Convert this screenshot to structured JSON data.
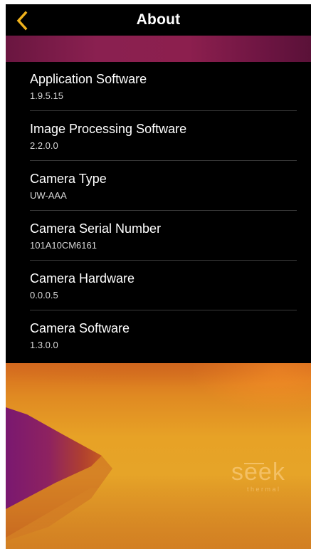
{
  "header": {
    "title": "About",
    "back_icon": "chevron-left-icon",
    "accent_color": "#f0b21c"
  },
  "banner": {
    "color": "#8a2050"
  },
  "about_items": [
    {
      "label": "Application Software",
      "value": "1.9.5.15"
    },
    {
      "label": "Image Processing Software",
      "value": "2.2.0.0"
    },
    {
      "label": "Camera Type",
      "value": "UW-AAA"
    },
    {
      "label": "Camera Serial Number",
      "value": "101A10CM6161"
    },
    {
      "label": "Camera Hardware",
      "value": "0.0.0.5"
    },
    {
      "label": "Camera Software",
      "value": "1.3.0.0"
    }
  ],
  "thermal_view": {
    "logo_text": "seek",
    "logo_subtext": "thermal"
  }
}
